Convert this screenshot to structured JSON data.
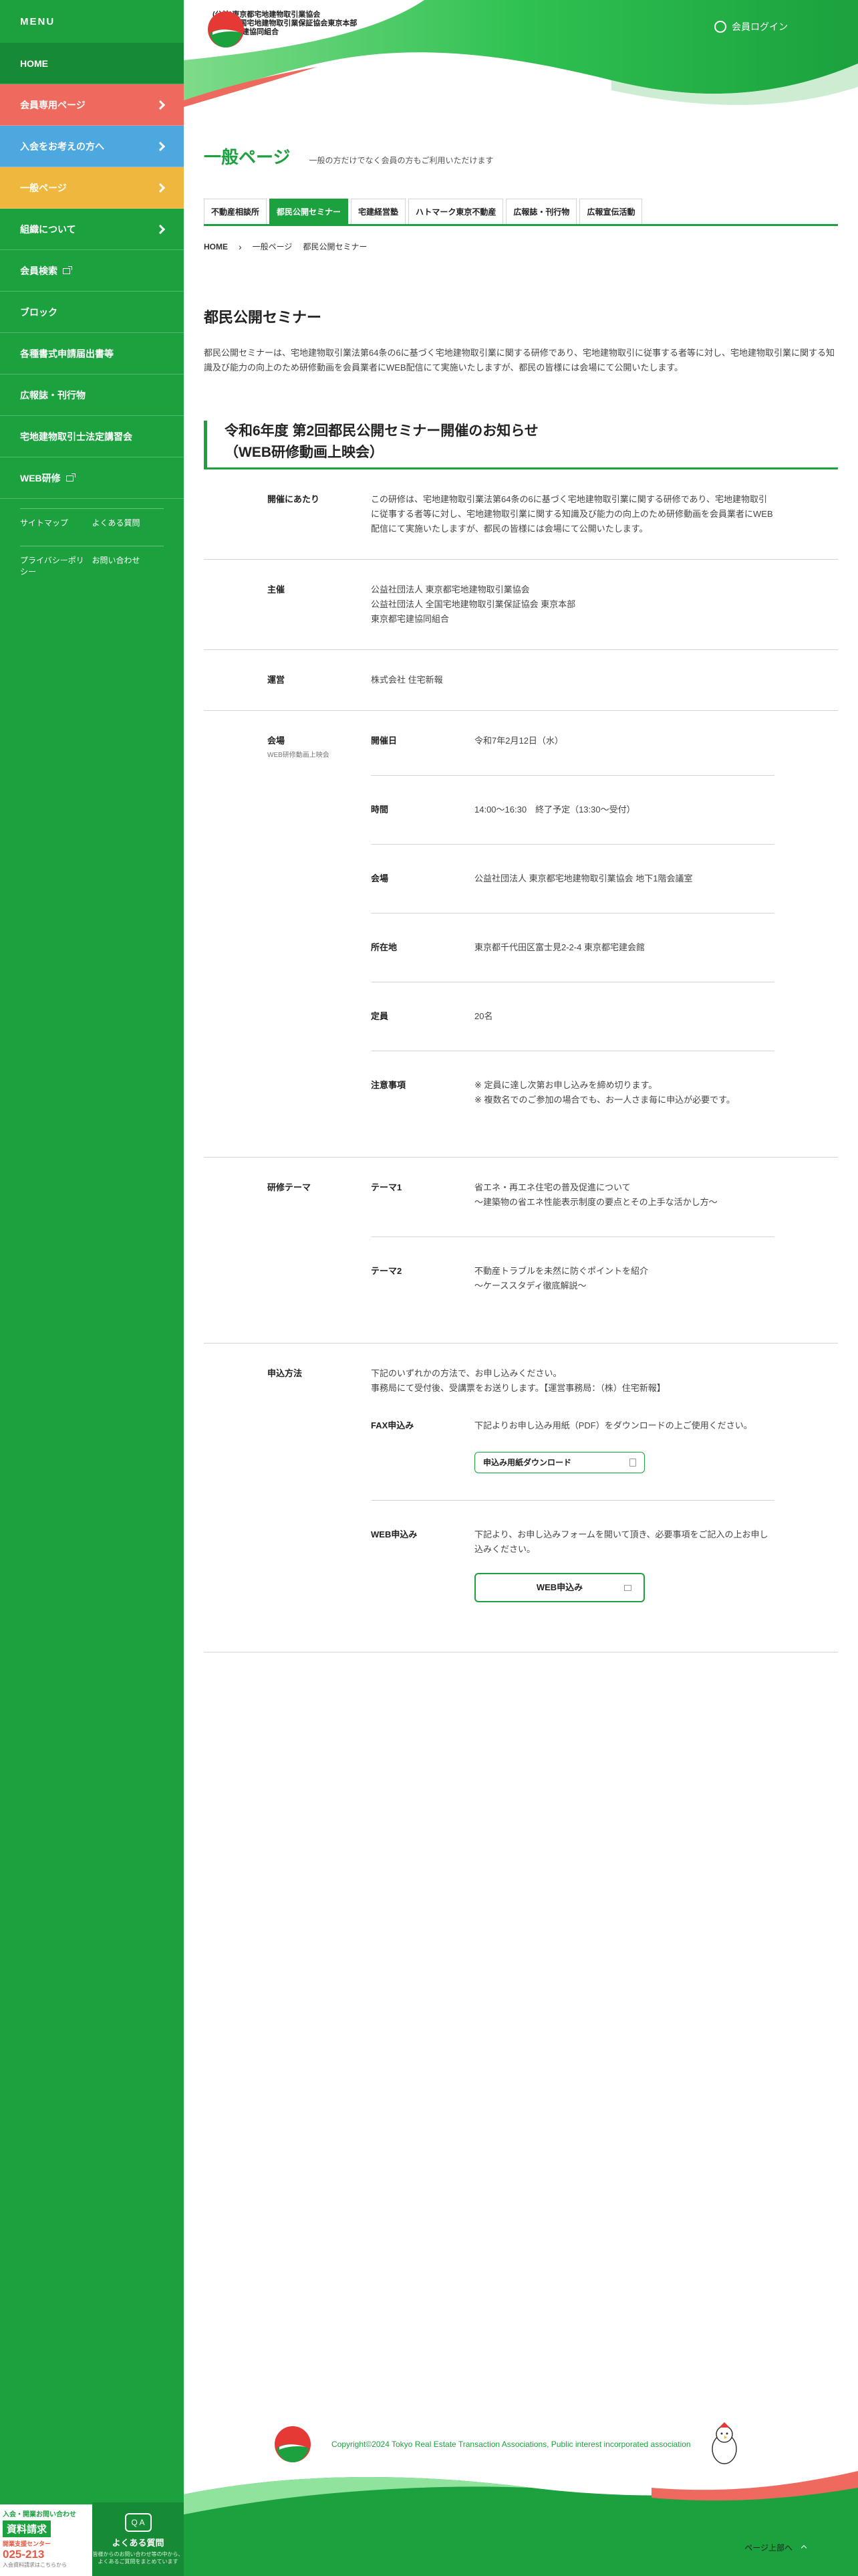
{
  "sidebar": {
    "menu_title": "MENU",
    "items": [
      {
        "label": "HOME"
      },
      {
        "label": "会員専用ページ"
      },
      {
        "label": "入会をお考えの方へ"
      },
      {
        "label": "一般ページ"
      },
      {
        "label": "組織について"
      },
      {
        "label": "会員検索"
      },
      {
        "label": "ブロック"
      },
      {
        "label": "各種書式申請届出書等"
      },
      {
        "label": "広報誌・刊行物"
      },
      {
        "label": "宅地建物取引士法定講習会"
      },
      {
        "label": "WEB研修"
      }
    ],
    "sub_links": [
      "サイトマップ",
      "よくある質問",
      "プライバシーポリシー",
      "お問い合わせ"
    ],
    "banner": {
      "line1": "入会・開業お問い合わせ",
      "line2": "資料請求",
      "line3": "開業支援センター",
      "phone": "025-213",
      "line5": "入会資料請求はこちらから",
      "faq_icon": "Q A",
      "faq_label": "よくある質問",
      "faq_sub": "皆様からのお問い合わせ等の中から、よくあるご質問をまとめています"
    }
  },
  "header": {
    "logo_lines": [
      "(公社)東京都宅地建物取引業協会",
      "(公社)全国宅地建物取引業保証協会東京本部",
      "東京都宅建協同組合"
    ],
    "login_label": "会員ログイン"
  },
  "page": {
    "title": "一般ページ",
    "subtitle": "一般の方だけでなく会員の方もご利用いただけます",
    "tabs": [
      "不動産相談所",
      "都民公開セミナー",
      "宅建経営塾",
      "ハトマーク東京不動産",
      "広報誌・刊行物",
      "広報宣伝活動"
    ],
    "breadcrumb": [
      "HOME",
      "一般ページ",
      "都民公開セミナー"
    ],
    "section_title": "都民公開セミナー",
    "intro": "都民公開セミナーは、宅地建物取引業法第64条の6に基づく宅地建物取引業に関する研修であり、宅地建物取引に従事する者等に対し、宅地建物取引業に関する知識及び能力の向上のため研修動画を会員業者にWEB配信にて実施いたしますが、都民の皆様には会場にて公開いたします。",
    "notice_title_1": "令和6年度 第2回都民公開セミナー開催のお知らせ",
    "notice_title_2": "（WEB研修動画上映会）"
  },
  "info": {
    "purpose_label": "開催にあたり",
    "purpose": "この研修は、宅地建物取引業法第64条の6に基づく宅地建物取引業に関する研修であり、宅地建物取引に従事する者等に対し、宅地建物取引業に関する知識及び能力の向上のため研修動画を会員業者にWEB配信にて実施いたしますが、都民の皆様には会場にて公開いたします。",
    "host_label": "主催",
    "host": [
      "公益社団法人 東京都宅地建物取引業協会",
      "公益社団法人 全国宅地建物取引業保証協会 東京本部",
      "東京都宅建協同組合"
    ],
    "operation_label": "運営",
    "operation": "株式会社 住宅新報",
    "venue_label": "会場",
    "venue_sublabel": "WEB研修動画上映会",
    "venue_rows": [
      {
        "label": "開催日",
        "value": "令和7年2月12日（水）"
      },
      {
        "label": "時間",
        "value": "14:00〜16:30　終了予定（13:30〜受付）"
      },
      {
        "label": "会場",
        "value": "公益社団法人 東京都宅地建物取引業協会 地下1階会議室"
      },
      {
        "label": "所在地",
        "value": "東京都千代田区富士見2-2-4 東京都宅建会館"
      },
      {
        "label": "定員",
        "value": "20名"
      }
    ],
    "notes_label": "注意事項",
    "notes": [
      "※ 定員に達し次第お申し込みを締め切ります。",
      "※ 複数名でのご参加の場合でも、お一人さま毎に申込が必要です。"
    ],
    "theme_label": "研修テーマ",
    "themes": [
      {
        "label": "テーマ1",
        "lines": [
          "省エネ・再エネ住宅の普及促進について",
          "〜建築物の省エネ性能表示制度の要点とその上手な活かし方〜"
        ]
      },
      {
        "label": "テーマ2",
        "lines": [
          "不動産トラブルを未然に防ぐポイントを紹介",
          "〜ケーススタディ徹底解説〜"
        ]
      }
    ],
    "apply_label": "申込方法",
    "apply_intro": [
      "下記のいずれかの方法で、お申し込みください。",
      "事務局にて受付後、受講票をお送りします。【運営事務局：（株）住宅新報】"
    ],
    "fax_label": "FAX申込み",
    "fax_text": "下記よりお申し込み用紙（PDF）をダウンロードの上ご使用ください。",
    "fax_button": "申込み用紙ダウンロード",
    "web_label": "WEB申込み",
    "web_text": "下記より、お申し込みフォームを開いて頂き、必要事項をご記入の上お申し込みください。",
    "web_button": "WEB申込み"
  },
  "footer": {
    "copyright": "Copyright©2024 Tokyo Real Estate Transaction Associations, Public interest incorporated association",
    "pagetop": "ページ上部へ"
  },
  "colors": {
    "green": "#1ba13e",
    "dark_green": "#178a36",
    "coral": "#ef6a5e",
    "blue": "#4ea8e0",
    "yellow": "#efb73e"
  }
}
